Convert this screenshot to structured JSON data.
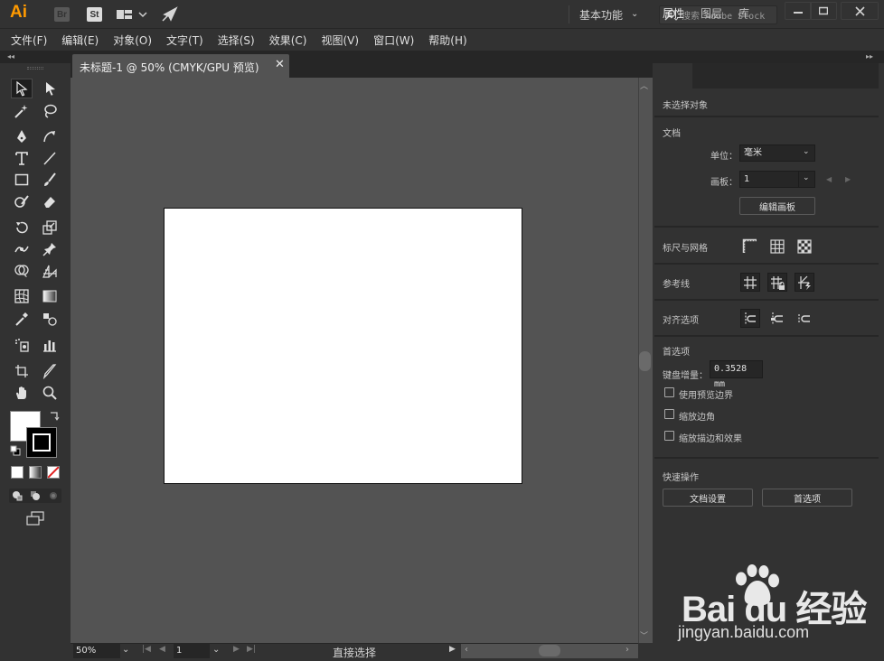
{
  "app": {
    "logo": "Ai",
    "bridge_badge": "Br",
    "stock_badge": "St",
    "workspace": "基本功能",
    "search_placeholder": "搜索 Adobe Stock"
  },
  "menu": [
    "文件(F)",
    "编辑(E)",
    "对象(O)",
    "文字(T)",
    "选择(S)",
    "效果(C)",
    "视图(V)",
    "窗口(W)",
    "帮助(H)"
  ],
  "document": {
    "tab_title": "未标题-1 @ 50% (CMYK/GPU 预览)",
    "tab_close": "✕"
  },
  "status": {
    "zoom": "50%",
    "artboard": "1",
    "tool_name": "直接选择"
  },
  "panel": {
    "tabs": [
      "属性",
      "图层",
      "库"
    ],
    "no_selection": "未选择对象",
    "document_section": "文档",
    "units_label": "单位：",
    "units_value": "毫米",
    "artboard_label": "画板：",
    "artboard_value": "1",
    "edit_artboards": "编辑画板",
    "rulers_grids": "标尺与网格",
    "guides": "参考线",
    "align_options": "对齐选项",
    "preferences": "首选项",
    "keyboard_increment_label": "键盘增量：",
    "keyboard_increment_value": "0.3528 mm",
    "use_preview_bounds": "使用预览边界",
    "scale_corners": "缩放边角",
    "scale_strokes_effects": "缩放描边和效果",
    "quick_actions": "快速操作",
    "document_setup": "文档设置",
    "preferences_button": "首选项"
  },
  "watermark": {
    "main": "Bai du 经验",
    "sub": "jingyan.baidu.com"
  },
  "colors": {
    "accent": "#ff9a00",
    "ui_dark": "#323232",
    "canvas": "#535353",
    "artboard": "#ffffff"
  }
}
